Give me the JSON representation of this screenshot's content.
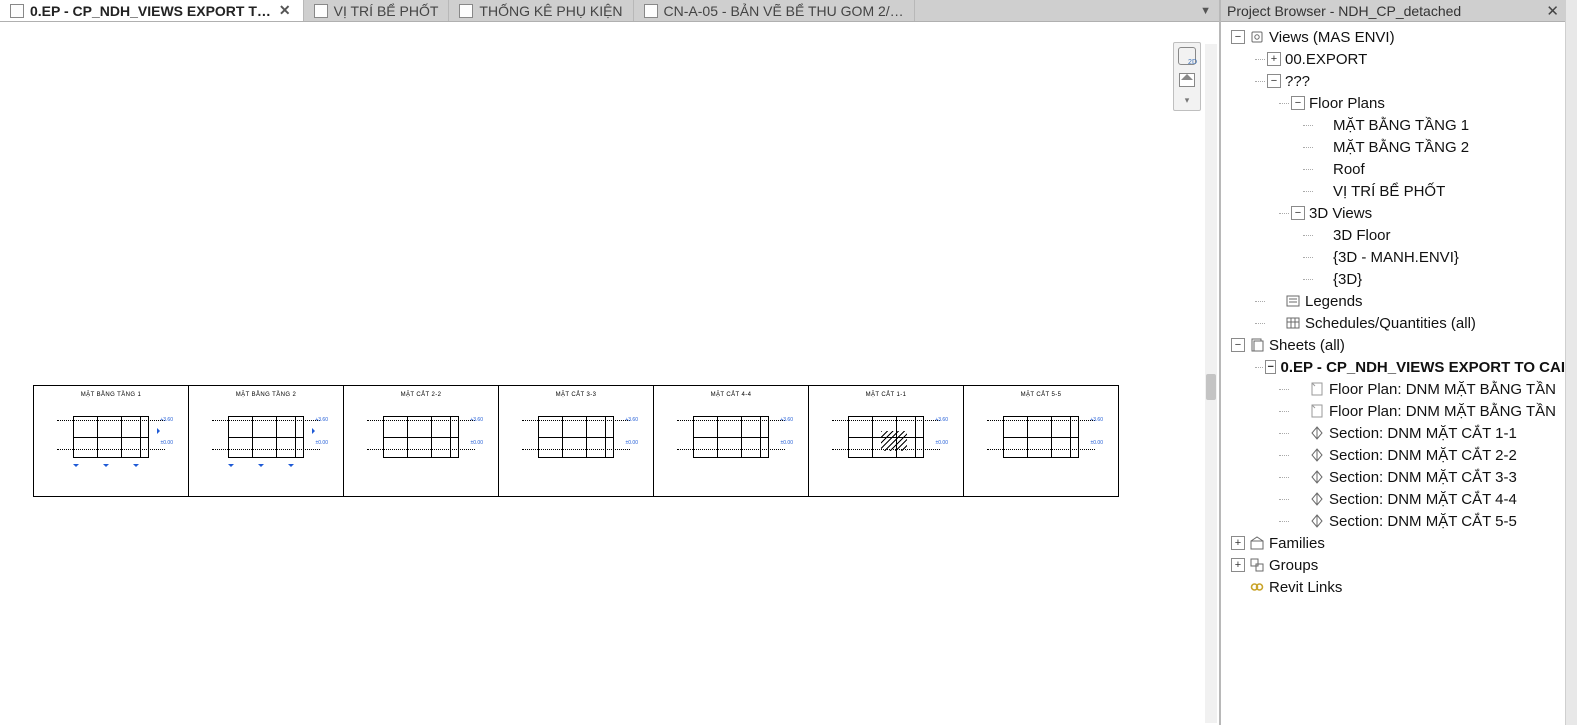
{
  "tabs": [
    {
      "label": "0.EP - CP_NDH_VIEWS EXPORT T…",
      "active": true,
      "closable": true
    },
    {
      "label": "VỊ TRÍ BỂ PHỐT",
      "active": false,
      "closable": false
    },
    {
      "label": "THỐNG KÊ PHỤ KIỆN",
      "active": false,
      "closable": false
    },
    {
      "label": "CN-A-05 - BẢN VẼ BỂ THU GOM 2/…",
      "active": false,
      "closable": false
    }
  ],
  "thumbs": [
    {
      "title": "MẶT BẰNG TẦNG 1",
      "kind": "plan"
    },
    {
      "title": "MẶT BẰNG TẦNG 2",
      "kind": "plan"
    },
    {
      "title": "MẶT CẮT 2-2",
      "kind": "sec"
    },
    {
      "title": "MẶT CẮT 3-3",
      "kind": "sec"
    },
    {
      "title": "MẶT CẮT 4-4",
      "kind": "sec"
    },
    {
      "title": "MẶT CẮT 1-1",
      "kind": "sec"
    },
    {
      "title": "MẶT CẮT 5-5",
      "kind": "sec"
    }
  ],
  "browser": {
    "title": "Project Browser - NDH_CP_detached",
    "rows": [
      {
        "d": 0,
        "tw": "-",
        "icon": "views",
        "label": "Views (MAS ENVI)"
      },
      {
        "d": 1,
        "tw": "+",
        "icon": "",
        "label": "00.EXPORT"
      },
      {
        "d": 1,
        "tw": "-",
        "icon": "",
        "label": "???"
      },
      {
        "d": 2,
        "tw": "-",
        "icon": "",
        "label": "Floor Plans"
      },
      {
        "d": 3,
        "tw": "",
        "icon": "",
        "label": "MẶT BẰNG TẦNG 1"
      },
      {
        "d": 3,
        "tw": "",
        "icon": "",
        "label": "MẶT BẰNG TẦNG 2"
      },
      {
        "d": 3,
        "tw": "",
        "icon": "",
        "label": "Roof"
      },
      {
        "d": 3,
        "tw": "",
        "icon": "",
        "label": "VỊ TRÍ BỂ PHỐT"
      },
      {
        "d": 2,
        "tw": "-",
        "icon": "",
        "label": "3D Views"
      },
      {
        "d": 3,
        "tw": "",
        "icon": "",
        "label": "3D Floor"
      },
      {
        "d": 3,
        "tw": "",
        "icon": "",
        "label": "{3D - MANH.ENVI}"
      },
      {
        "d": 3,
        "tw": "",
        "icon": "",
        "label": "{3D}"
      },
      {
        "d": 1,
        "tw": "",
        "icon": "legend",
        "label": "Legends"
      },
      {
        "d": 1,
        "tw": "",
        "icon": "sched",
        "label": "Schedules/Quantities (all)"
      },
      {
        "d": 0,
        "tw": "-",
        "icon": "sheets",
        "label": "Sheets (all)"
      },
      {
        "d": 1,
        "tw": "-",
        "icon": "",
        "label": "0.EP - CP_NDH_VIEWS EXPORT TO CAI",
        "sel": true
      },
      {
        "d": 2,
        "tw": "",
        "icon": "plan",
        "label": "Floor Plan: DNM MẶT BẰNG TẦN"
      },
      {
        "d": 2,
        "tw": "",
        "icon": "plan",
        "label": "Floor Plan: DNM MẶT BẰNG TẦN"
      },
      {
        "d": 2,
        "tw": "",
        "icon": "section",
        "label": "Section: DNM MẶT CẮT 1-1"
      },
      {
        "d": 2,
        "tw": "",
        "icon": "section",
        "label": "Section: DNM MẶT CẮT 2-2"
      },
      {
        "d": 2,
        "tw": "",
        "icon": "section",
        "label": "Section: DNM MẶT CẮT 3-3"
      },
      {
        "d": 2,
        "tw": "",
        "icon": "section",
        "label": "Section: DNM MẶT CẮT 4-4"
      },
      {
        "d": 2,
        "tw": "",
        "icon": "section",
        "label": "Section: DNM MẶT CẮT 5-5"
      },
      {
        "d": 0,
        "tw": "+",
        "icon": "fam",
        "label": "Families"
      },
      {
        "d": 0,
        "tw": "+",
        "icon": "grp",
        "label": "Groups"
      },
      {
        "d": 0,
        "tw": "",
        "icon": "link",
        "label": "Revit Links"
      }
    ]
  }
}
